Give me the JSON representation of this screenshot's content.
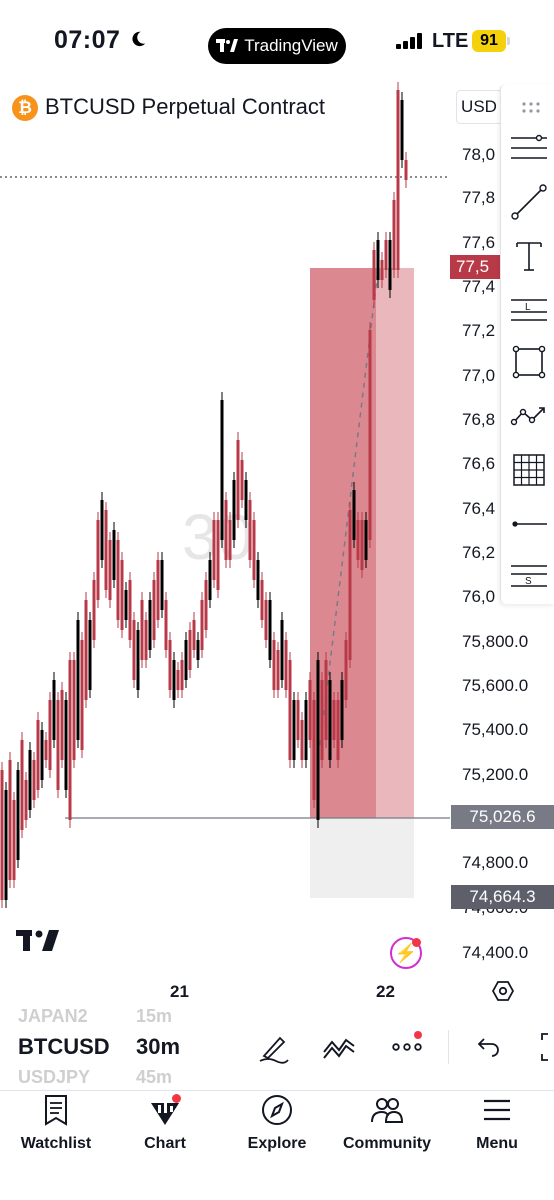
{
  "status_bar": {
    "time": "07:07",
    "app_pill": "TradingView",
    "network": "LTE",
    "battery": "91"
  },
  "header": {
    "symbol_title": "BTCUSD Perpetual Contract",
    "currency": "USD",
    "coin_glyph": "₿"
  },
  "chart": {
    "watermark": "30",
    "price_axis": [
      "78,0",
      "77,8",
      "77,6",
      "77,4",
      "77,2",
      "77,0",
      "76,8",
      "76,6",
      "76,4",
      "76,2",
      "76,0",
      "75,800.0",
      "75,600.0",
      "75,400.0",
      "75,200.0",
      "74,800.0",
      "74,600.0",
      "74,400.0"
    ],
    "current_price_tag": "77,5",
    "entry_price_tag": "75,026.6",
    "stop_price_tag": "74,664.3",
    "time_axis": [
      "21",
      "22"
    ],
    "colors": {
      "up": "#b83a48",
      "down": "#000000",
      "profit_zone": "#d0616b",
      "stop_zone": "#efefef",
      "current_tag": "#b83a48",
      "entry_tag": "#787b86",
      "stop_tag": "#5d606b"
    }
  },
  "symbol_row": {
    "prev_symbol": "JAPAN2",
    "prev_interval": "15m",
    "symbol": "BTCUSD",
    "interval": "30m",
    "next_symbol": "USDJPY",
    "next_interval": "45m"
  },
  "nav": {
    "watchlist": "Watchlist",
    "chart": "Chart",
    "explore": "Explore",
    "community": "Community",
    "menu": "Menu"
  }
}
